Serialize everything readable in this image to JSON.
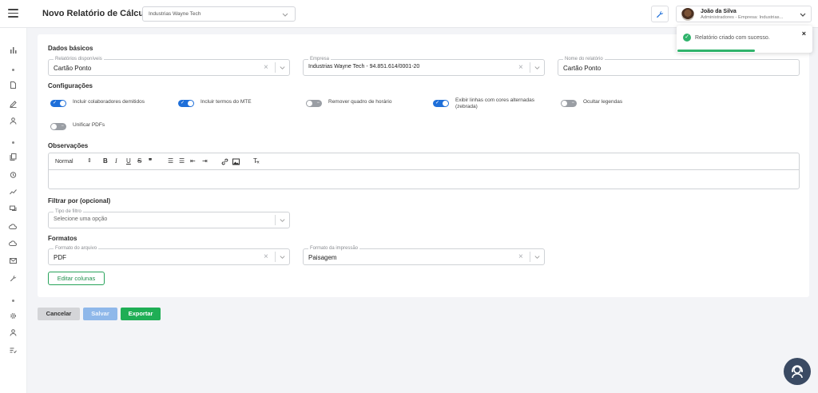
{
  "header": {
    "title": "Novo Relatório de Cálculos",
    "company_select": "Industrias Wayne Tech",
    "user_name": "João da Silva",
    "user_role": "Administradores - Empresa: Industrias..."
  },
  "toast": {
    "message": "Relatório criado com sucesso.",
    "close": "×",
    "progress": 0.58,
    "accent": "#2fb36b"
  },
  "basic": {
    "section": "Dados básicos",
    "reports_label": "Relatórios disponíveis",
    "reports_value": "Cartão Ponto",
    "company_label": "Empresa",
    "company_value": "Industrias Wayne Tech - 94.851.614/0001-20",
    "name_label": "Nome do relatório",
    "name_value": "Cartão Ponto"
  },
  "config": {
    "section": "Configurações",
    "toggles": [
      {
        "label": "Incluir colaboradores demitidos",
        "on": true
      },
      {
        "label": "Incluir termos do MTE",
        "on": true
      },
      {
        "label": "Remover quadro de horário",
        "on": false
      },
      {
        "label": "Exibir linhas com cores alternadas",
        "label2": "(zebrada)",
        "on": true
      },
      {
        "label": "Ocultar legendas",
        "on": false
      },
      {
        "label": "Unificar PDFs",
        "on": false
      }
    ]
  },
  "notes": {
    "section": "Observações",
    "style_select": "Normal",
    "toolbar_icons": [
      "bold-icon",
      "italic-icon",
      "underline-icon",
      "strike-icon",
      "quote-icon",
      "ordered-list-icon",
      "bullet-list-icon",
      "indent-decrease-icon",
      "indent-increase-icon",
      "link-icon",
      "image-icon",
      "clear-format-icon"
    ]
  },
  "filter": {
    "section": "Filtrar por (opcional)",
    "type_label": "Tipo de filtro",
    "type_placeholder": "Selecione uma opção"
  },
  "formats": {
    "section": "Formatos",
    "file_label": "Formato do arquivo",
    "file_value": "PDF",
    "print_label": "Formato da impressão",
    "print_value": "Paisagem",
    "edit_columns": "Editar colunas"
  },
  "actions": {
    "cancel": "Cancelar",
    "save": "Salvar",
    "export": "Exportar"
  },
  "colors": {
    "primary": "#1e6fd9",
    "success": "#27a35a",
    "export": "#1fae55",
    "save_disabled": "#8fb8ea"
  }
}
